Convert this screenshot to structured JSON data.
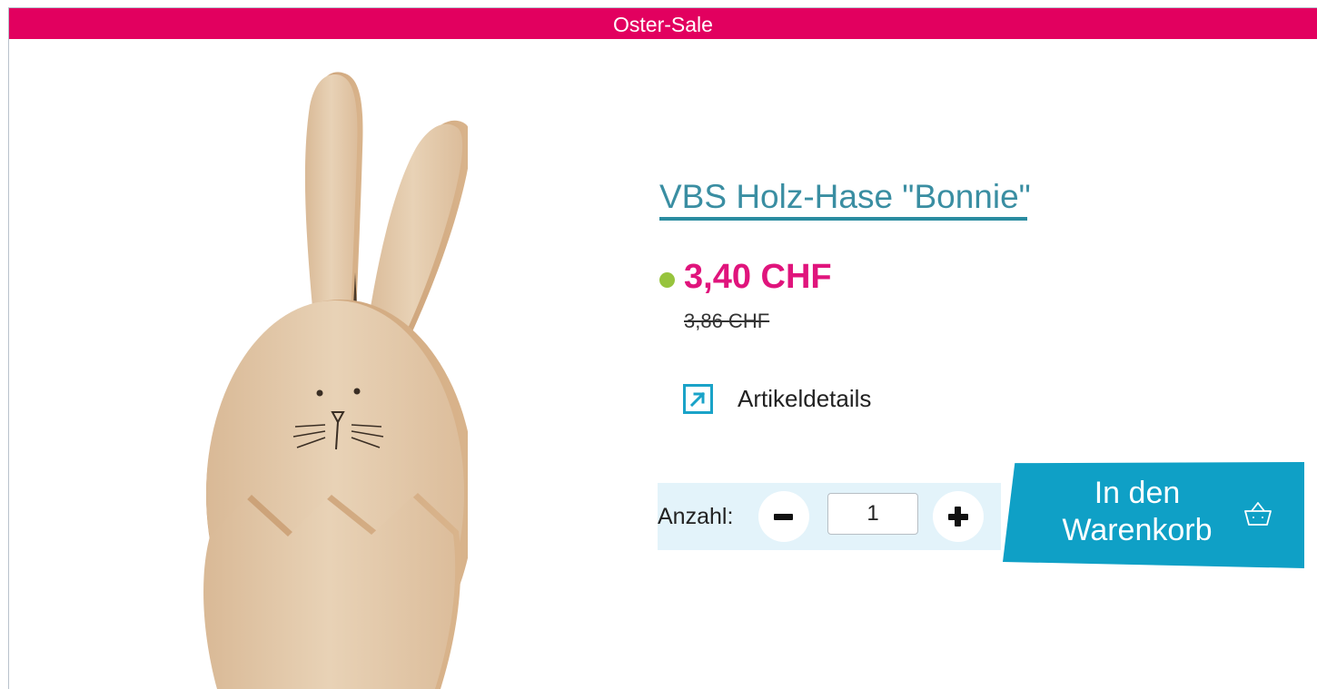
{
  "banner": {
    "text": "Oster-Sale"
  },
  "product": {
    "title": "VBS Holz-Hase \"Bonnie\"",
    "price": "3,40 CHF",
    "old_price": "3,86 CHF",
    "details_label": "Artikeldetails",
    "image_icon": "wooden-bunny-image"
  },
  "quantity": {
    "label": "Anzahl:",
    "value": "1",
    "minus_icon": "minus-icon",
    "plus_icon": "plus-icon"
  },
  "cart": {
    "label_line1": "In den",
    "label_line2": "Warenkorb",
    "icon": "basket-icon"
  },
  "colors": {
    "banner": "#e2005f",
    "price": "#e0147c",
    "availability_dot": "#97c43d",
    "title": "#3a8ea2",
    "cart_button": "#0fa0c6",
    "quantity_bg": "#e3f3fa"
  }
}
